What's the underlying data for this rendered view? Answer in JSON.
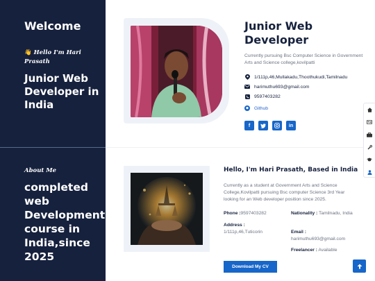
{
  "sidebar": {
    "welcome": "Welcome",
    "hello": "Hello I'm Hari Prasath",
    "wave_icon": "waving-hand-icon",
    "role": "Junior Web Developer in India",
    "about_label": "About Me",
    "about_text": "completed web Development course in India,since 2025"
  },
  "hero": {
    "title": "Junior Web Developer",
    "description": "Currently pursuing Bsc Computer Science in Government Arts and Science college,kovilpatti",
    "address": "1/111p,46,Mullakadu,Thoothukudi,Tamilnadu",
    "email": "harimuthu693@gmail.com",
    "phone": "9597403282",
    "github": "Github",
    "socials": [
      "facebook-icon",
      "twitter-icon",
      "instagram-icon",
      "linkedin-icon"
    ]
  },
  "about": {
    "title": "Hello, I'm Hari Prasath, Based in India",
    "description": "Currently as a student at Government Arts and Science College,Kovilpatti pursuing Bsc computer Science 3rd Year looking for an Web developer position since 2025.",
    "phone_label": "Phone :",
    "phone_value": "9597403282",
    "address_label": "Address :",
    "address_value": "1/111p,46,Tuticorin",
    "nationality_label": "Nationality :",
    "nationality_value": "Tamilnadu, India",
    "email_label": "Email :",
    "email_value": "harimuthu693@gmail.com",
    "freelancer_label": "Freelancer :",
    "freelancer_value": "Available",
    "cv_button": "Download My CV"
  },
  "side_nav": [
    "home-icon",
    "id-card-icon",
    "briefcase-icon",
    "tools-icon",
    "graduation-cap-icon",
    "user-icon"
  ],
  "colors": {
    "navy": "#16213d",
    "accent": "#1766c9",
    "muted": "#6b7280"
  }
}
